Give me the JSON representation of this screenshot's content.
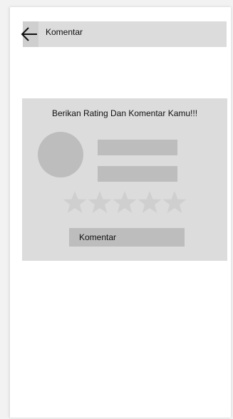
{
  "header": {
    "title": "Komentar",
    "back_icon": "arrow-left-icon"
  },
  "card": {
    "heading": "Berikan Rating Dan Komentar Kamu!!!",
    "rating": {
      "filled": 0,
      "max": 5
    },
    "comment_button_label": "Komentar"
  },
  "colors": {
    "panel": "#dcdcdc",
    "placeholder": "#bdbdbd",
    "star": "#cfcfcf"
  }
}
